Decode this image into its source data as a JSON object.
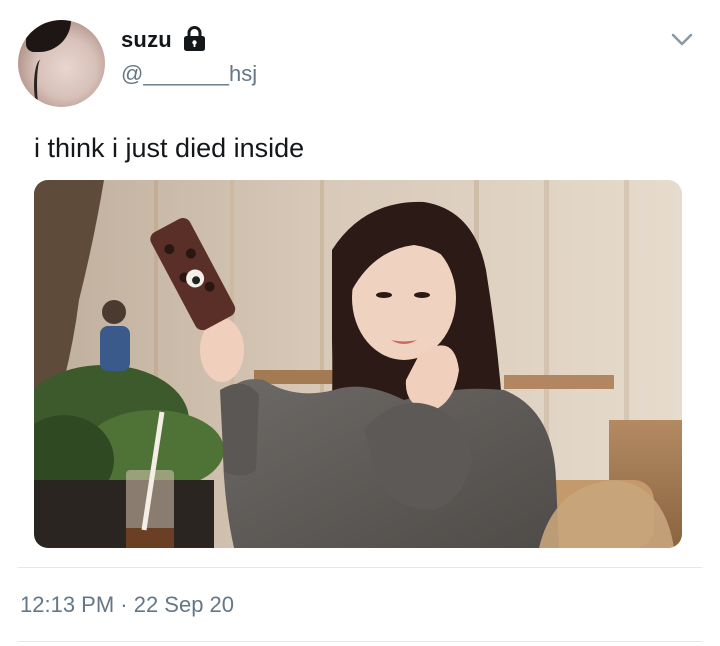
{
  "tweet": {
    "author": {
      "display_name": "suzu",
      "handle": "@_______hsj",
      "protected_icon": "lock-icon"
    },
    "menu_icon": "chevron-down-icon",
    "text": "i think i just died inside",
    "media": {
      "type": "photo"
    },
    "timestamp": "12:13 PM · 22 Sep 20"
  },
  "colors": {
    "primary_text": "#14171a",
    "secondary_text": "#657786",
    "divider": "#e1e8ed"
  }
}
